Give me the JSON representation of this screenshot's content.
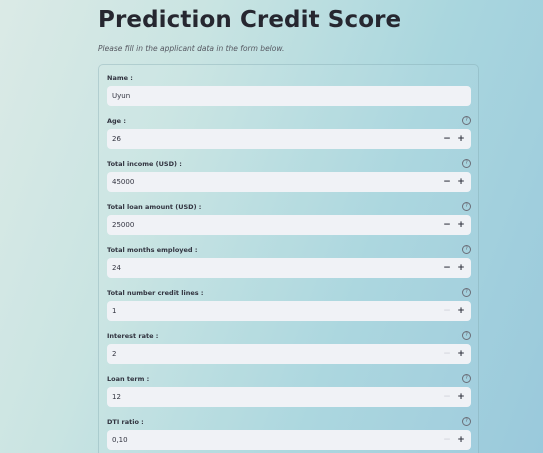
{
  "header": {
    "title": "Prediction Credit Score",
    "subtitle": "Please fill in the applicant data in the form below."
  },
  "form": {
    "fields": [
      {
        "label": "Name :",
        "value": "Uyun"
      },
      {
        "label": "Age :",
        "value": "26",
        "help_icon": "help-circle-icon"
      },
      {
        "label": "Total income (USD) :",
        "value": "45000",
        "help_icon": "help-circle-icon"
      },
      {
        "label": "Total loan amount (USD) :",
        "value": "25000",
        "help_icon": "help-circle-icon"
      },
      {
        "label": "Total months employed :",
        "value": "24",
        "help_icon": "help-circle-icon"
      },
      {
        "label": "Total number credit lines :",
        "value": "1",
        "help_icon": "help-circle-icon",
        "minus_disabled": true
      },
      {
        "label": "Interest rate :",
        "value": "2",
        "help_icon": "help-circle-icon",
        "minus_disabled": true
      },
      {
        "label": "Loan term :",
        "value": "12",
        "help_icon": "help-circle-icon",
        "minus_disabled": true
      },
      {
        "label": "DTI ratio :",
        "value": "0,10",
        "help_icon": "help-circle-icon",
        "minus_disabled": true
      }
    ],
    "help_glyph": "?",
    "minus_glyph": "−",
    "plus_glyph": "+"
  }
}
